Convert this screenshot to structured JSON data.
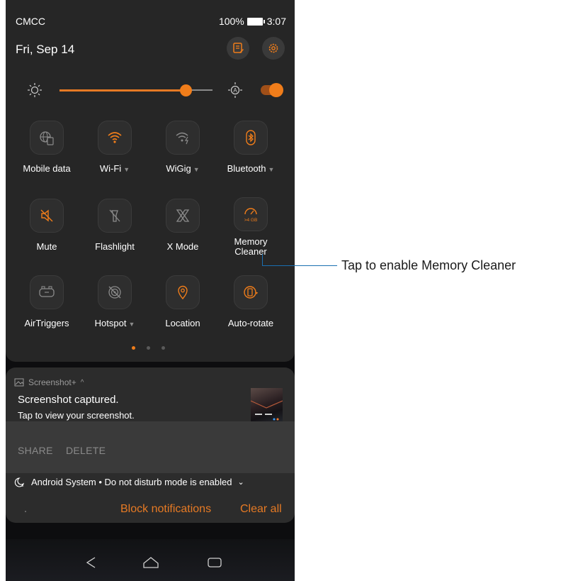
{
  "status_bar": {
    "carrier": "CMCC",
    "battery": "100%",
    "time": "3:07"
  },
  "header": {
    "date": "Fri, Sep 14",
    "icons": [
      "edit-icon",
      "settings-gear-icon"
    ]
  },
  "brightness": {
    "level_percent": 76,
    "auto_enabled": true
  },
  "quick_tiles": [
    {
      "label": "Mobile data",
      "icon": "globe-sim-icon",
      "active": false,
      "dropdown": false
    },
    {
      "label": "Wi-Fi",
      "icon": "wifi-icon",
      "active": true,
      "dropdown": true
    },
    {
      "label": "WiGig",
      "icon": "wigig-icon",
      "active": false,
      "dropdown": true
    },
    {
      "label": "Bluetooth",
      "icon": "bluetooth-icon",
      "active": true,
      "dropdown": true
    },
    {
      "label": "Mute",
      "icon": "mute-icon",
      "active": true,
      "dropdown": false
    },
    {
      "label": "Flashlight",
      "icon": "flashlight-icon",
      "active": false,
      "dropdown": false
    },
    {
      "label": "X Mode",
      "icon": "x-mode-icon",
      "active": false,
      "dropdown": false
    },
    {
      "label": "Memory Cleaner",
      "icon": "memory-cleaner-icon",
      "badge": ">4 GB",
      "active": true,
      "dropdown": false
    },
    {
      "label": "AirTriggers",
      "icon": "airtriggers-icon",
      "active": false,
      "dropdown": false
    },
    {
      "label": "Hotspot",
      "icon": "hotspot-icon",
      "active": false,
      "dropdown": true
    },
    {
      "label": "Location",
      "icon": "location-pin-icon",
      "active": true,
      "dropdown": false
    },
    {
      "label": "Auto-rotate",
      "icon": "auto-rotate-icon",
      "active": true,
      "dropdown": false
    }
  ],
  "page_dots": {
    "count": 3,
    "active": 0
  },
  "notification": {
    "app": "Screenshot+",
    "title": "Screenshot captured.",
    "text": "Tap to view your screenshot.",
    "actions": [
      "SHARE",
      "DELETE"
    ]
  },
  "dnd_notice": "Android System • Do not disturb mode is enabled",
  "footer": {
    "block": "Block notifications",
    "clear": "Clear all"
  },
  "callout": "Tap to enable Memory Cleaner",
  "colors": {
    "accent": "#f07d1a",
    "panel": "#262626",
    "callout_line": "#1a6fb0"
  }
}
